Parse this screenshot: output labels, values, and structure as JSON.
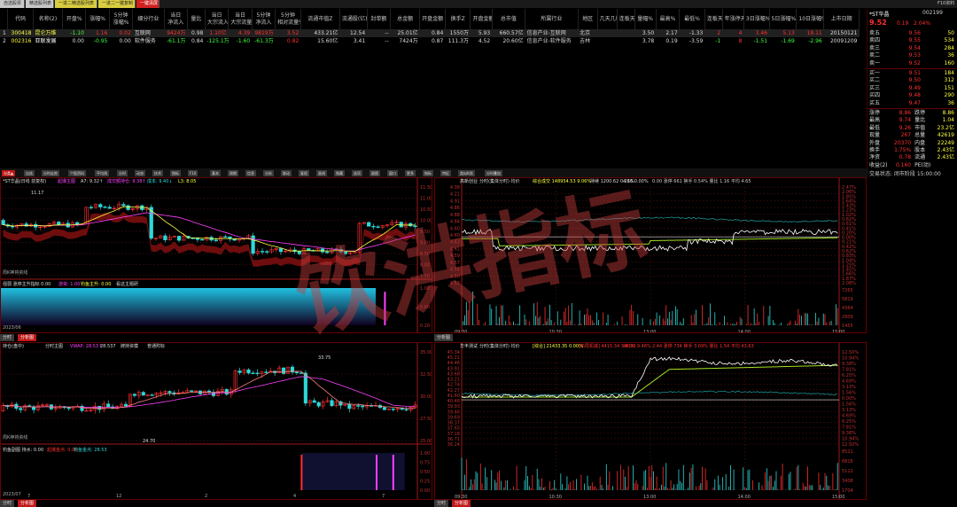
{
  "top_tabs": [
    {
      "label": "自选股票",
      "bg": "#c8c8c8",
      "fg": "#222"
    },
    {
      "label": "精选股列表",
      "bg": "#c8c8c8",
      "fg": "#222"
    },
    {
      "label": "一进二精选股列表",
      "bg": "#d8cc40",
      "fg": "#222"
    },
    {
      "label": "一进二一键复制",
      "bg": "#d8cc40",
      "fg": "#222"
    },
    {
      "label": "一键清屏",
      "bg": "#d02020",
      "fg": "#fff"
    }
  ],
  "right_top": "F10资料",
  "table": {
    "headers": [
      "",
      "代码",
      "名称(2)",
      "开盘%",
      "涨幅%",
      "5分钟\n涨幅%",
      "细分行业",
      "当日\n净流入",
      "量比",
      "当日\n大宗流入",
      "当日\n大宗流量%",
      "5分钟\n净流入",
      "5分钟\n相对流量%",
      "流通市值Z",
      "流通股(亿)",
      "封单额",
      "总金额",
      "开盘金额",
      "换手Z",
      "开盘金额",
      "换手Z",
      "总市值",
      "所属行业",
      "地区",
      "几天几板",
      "连板天",
      "量幅%",
      "最高%",
      "最低%",
      "连板天",
      "年涨停天",
      "3日涨幅%",
      "5日涨幅%",
      "10日涨幅%",
      "上市日期"
    ],
    "rows": [
      [
        "1",
        "300418",
        "昆仑万维",
        "-1.10",
        "1.16",
        "0.02",
        "互联网",
        "9424万",
        "0.98",
        "1.10亿",
        "4.39",
        "9819万",
        "3.52",
        "433.21亿",
        "12.54",
        "--",
        "25.01亿",
        "0.84",
        "1550万",
        "5.93",
        "660.57亿",
        "信息产业-互联网",
        "北京",
        "",
        "",
        "3.50",
        "2.17",
        "-1.33",
        "2",
        "4",
        "3.46",
        "5.13",
        "18.11",
        "20150121"
      ],
      [
        "2",
        "002316",
        "亚联发展",
        "0.00",
        "-0.95",
        "0.00",
        "软件服务",
        "-61.1万",
        "0.84",
        "-125.1万",
        "-1.60",
        "-61.3万",
        "0.82",
        "15.60亿",
        "3.41",
        "--",
        "7424万",
        "0.87",
        "111.3万",
        "4.52",
        "20.60亿",
        "信息产业-软件服务",
        "吉林",
        "",
        "",
        "3.78",
        "0.19",
        "-3.59",
        "-1",
        "8",
        "-1.51",
        "-1.69",
        "-2.96",
        "20091209"
      ]
    ]
  },
  "quote": {
    "title": "*ST华晶",
    "code": "002199",
    "price": "9.52",
    "change": "0.19",
    "pct": "2.04%",
    "asks": [
      {
        "label": "卖五",
        "price": "9.56",
        "vol": "50"
      },
      {
        "label": "卖四",
        "price": "9.55",
        "vol": "534"
      },
      {
        "label": "卖三",
        "price": "9.54",
        "vol": "284"
      },
      {
        "label": "卖二",
        "price": "9.53",
        "vol": "36"
      },
      {
        "label": "卖一",
        "price": "9.52",
        "vol": "160"
      }
    ],
    "bids": [
      {
        "label": "买一",
        "price": "9.51",
        "vol": "184"
      },
      {
        "label": "买二",
        "price": "9.50",
        "vol": "312"
      },
      {
        "label": "买三",
        "price": "9.49",
        "vol": "151"
      },
      {
        "label": "买四",
        "price": "9.48",
        "vol": "290"
      },
      {
        "label": "买五",
        "price": "9.47",
        "vol": "36"
      }
    ],
    "stats": [
      {
        "l1": "涨停",
        "v1": "8.86",
        "l2": "跌停",
        "v2": "8.86"
      },
      {
        "l1": "最高",
        "v1": "9.74",
        "l2": "量比",
        "v2": "1.04"
      },
      {
        "l1": "最低",
        "v1": "9.26",
        "l2": "市值",
        "v2": "23.2亿"
      },
      {
        "l1": "现量",
        "v1": "267",
        "l2": "总量",
        "v2": "42619"
      },
      {
        "l1": "外盘",
        "v1": "20370",
        "l2": "内盘",
        "v2": "22249"
      },
      {
        "l1": "换手",
        "v1": "1.75%",
        "l2": "股本",
        "v2": "2.43亿"
      },
      {
        "l1": "净资",
        "v1": "0.78",
        "l2": "流通",
        "v2": "2.43亿"
      },
      {
        "l1": "收益(2)",
        "v1": "0.160",
        "l2": "PE(动)",
        "v2": ""
      }
    ],
    "status": "交易状态: 闭市阶段 15:00:00"
  },
  "toolbar": [
    "分类▲",
    "自选",
    "分时走势",
    "个股资料",
    "平均线",
    "分时",
    "动态",
    "技术",
    "指标",
    "F10",
    "基本",
    "周期",
    "信息",
    "分析",
    "联动",
    "复权",
    "画线",
    "隐藏",
    "选项",
    "副图",
    "窗口",
    "更多",
    "指标",
    "特征",
    "类似K线",
    "分时叠加"
  ],
  "k1": {
    "header": "*ST华晶(日线 前复权)",
    "indicator": "起爆主图",
    "ma_label": "A7: 9.32↑",
    "line1": "成交额持仓: 9.38↑",
    "line2": "成本: 9.40↓",
    "line3": "L3: 8.05",
    "high_mark": "11.17",
    "note": "周K神将资线",
    "y_ticks": [
      "11.50",
      "11.00",
      "10.50",
      "10.00",
      "9.50",
      "9.00",
      "8.50",
      "8.00",
      "7.50"
    ],
    "sub_title": "强弱 涨停主升指标 0.00",
    "sub_l1": "游资: 1.00",
    "sub_l2": "钓鱼主升: 0.00",
    "sub_l3": "看这主题研",
    "sub_ticks": [
      "1.00",
      "0.60",
      "0.20"
    ],
    "date_left": "2023/06"
  },
  "k2": {
    "header": "持仓(盘中)",
    "indicator": "分时主图",
    "ma_label": "VWAP: 28.53↑",
    "line1": "28.537",
    "line2": "牌持资模",
    "line3": "普通附标",
    "high_mark": "33.75",
    "low_mark": "24.70",
    "note": "周K神将资线",
    "y_ticks": [
      "35.00",
      "32.50",
      "30.00",
      "27.50",
      "25.00"
    ],
    "sub_title": "钓鱼副图 持水: 0.00",
    "sub_l1": "起爆金点: 0.00",
    "sub_l2": "钓鱼金点: 28.53",
    "sub_ticks": [
      "1.00",
      "0.75",
      "0.50",
      "0.25",
      "0.00"
    ],
    "x_ticks": [
      "7",
      "12",
      "2",
      "4",
      "7"
    ],
    "date_left": "2023/07"
  },
  "bottom_tabs": [
    "分时",
    "分析图"
  ],
  "t1": {
    "title": "高新创业",
    "subtitle": "分时(集体分时) 均价",
    "avg": "综合成交 148954.53 9.06%",
    "mid": "持续 1200.62 0.21%",
    "vol": "4.66 0.00%",
    "lbl": "0.00 涨停 661 换手 0.54% 量比 1.16 平均 4.65",
    "left_ticks": [
      "4.38",
      "4.21",
      "4.91",
      "4.86",
      "4.88",
      "4.84",
      "4.60",
      "4.60",
      "4.63",
      "4.61",
      "4.59",
      "4.57",
      "4.55",
      "4.50",
      "4.53"
    ],
    "right_ticks": [
      "2.47%",
      "2.06%",
      "1.85%",
      "1.64%",
      "1.43%",
      "1.23%",
      "1.02%",
      "0.82%",
      "0.61%",
      "0.41%",
      "0.20%",
      "0.00%",
      "0.21%",
      "0.42%",
      "0.62%",
      "0.83%",
      "1.04%",
      "1.25%",
      "1.45%",
      "1.66%",
      "1.87%",
      "2.08%"
    ],
    "vol_ticks": [
      "7265",
      "5819",
      "4364",
      "2909",
      "1455"
    ],
    "time_ticks": [
      "09:30",
      "10:30",
      "13:00",
      "14:00",
      "15:00"
    ]
  },
  "t2": {
    "title": "华丰测试",
    "subtitle": "分时(集体分时) 均价",
    "avg": "[综合] 21433.35 0.00%",
    "mid": "[布局机械] 4415.34 3.61%",
    "vol": "44.93 9.46%",
    "lbl": "2.44 涨停 734 换手 3.09% 量比 1.54 平均 43.63",
    "left_ticks": [
      "45.34",
      "45.21",
      "44.46",
      "43.91",
      "43.68",
      "43.21",
      "42.74",
      "42.27",
      "41.60",
      "40.48",
      "39.93",
      "39.46",
      "39.69",
      "38.37",
      "37.65",
      "37.18",
      "36.71",
      "36.24"
    ],
    "right_ticks": [
      "12.50%",
      "10.94%",
      "9.38%",
      "7.81%",
      "6.25%",
      "4.69%",
      "3.13%",
      "1.56%",
      "0.00%",
      "1.56%",
      "3.13%",
      "4.69%",
      "6.25%",
      "7.81%",
      "9.38%",
      "10.94%",
      "12.50%"
    ],
    "vol_ticks": [
      "8521",
      "6816",
      "5112",
      "3408",
      "1704"
    ],
    "time_ticks": [
      "09:30",
      "10:30",
      "13:00",
      "14:00",
      "15:00"
    ],
    "base": "40.84"
  },
  "watermark": "饮洪指标",
  "colors": {
    "up": "#ff3030",
    "down": "#2ed8d8",
    "yellow": "#ffff40",
    "magenta": "#ff40ff",
    "grid": "#501010",
    "axis": "#a01818"
  }
}
